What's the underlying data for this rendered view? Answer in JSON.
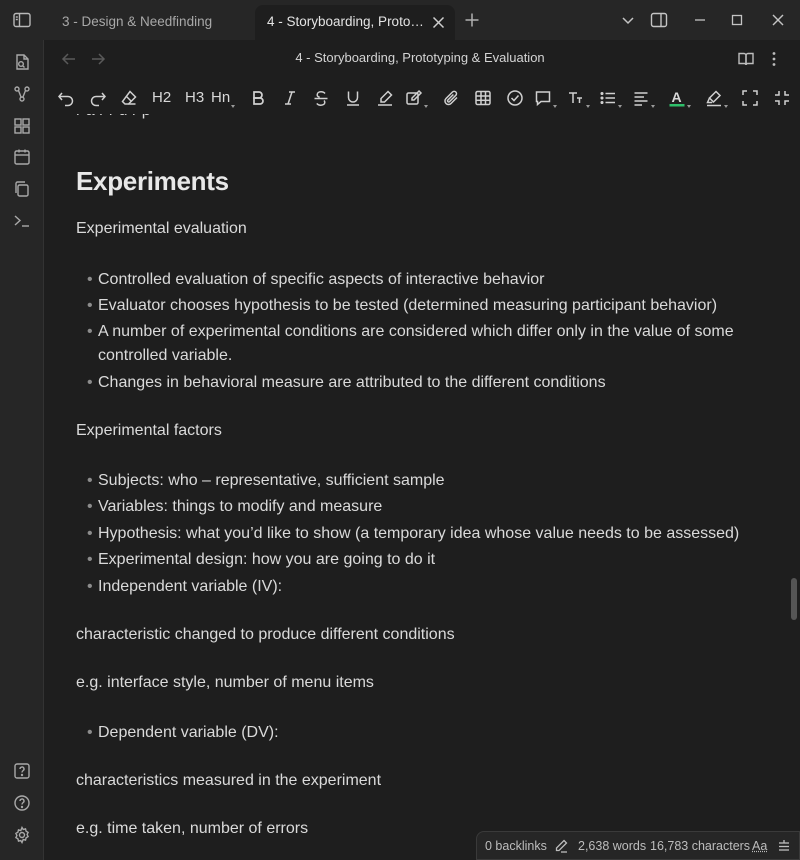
{
  "tabs": [
    {
      "title": "3 - Design & Needfinding"
    },
    {
      "title": "4 - Storyboarding, Prototyping & Evaluation"
    }
  ],
  "view": {
    "title": "4 - Storyboarding, Prototyping & Evaluation"
  },
  "toolbar": {
    "h2": "H2",
    "h3": "H3",
    "hn": "Hn"
  },
  "note": {
    "heading": "Experiments",
    "sections": [
      {
        "title": "Experimental evaluation",
        "bullets": [
          "Controlled evaluation of specific aspects of interactive behavior",
          "Evaluator chooses hypothesis to be tested (determined measuring participant behavior)",
          "A number of experimental conditions are considered which differ only in the value of some controlled variable.",
          "Changes in behavioral measure are attributed to the different conditions"
        ]
      },
      {
        "title": "Experimental factors",
        "bullets": [
          "Subjects: who – representative, sufficient sample",
          "Variables: things to modify and measure",
          "Hypothesis: what you’d like to show (a temporary idea whose value needs to be assessed)",
          "Experimental design: how you are going to do it",
          "Independent variable (IV):"
        ]
      }
    ],
    "iv_description": "characteristic changed to produce different conditions",
    "iv_example": "e.g. interface style, number of menu items",
    "dv_bullet": "Dependent variable (DV):",
    "dv_description": "characteristics measured in the experiment",
    "dv_example": "e.g. time taken, number of errors"
  },
  "status": {
    "backlinks": "0 backlinks",
    "words": "2,638 words",
    "characters": "16,783 characters",
    "font_toggle": "Aa"
  },
  "colors": {
    "text_color_accent": "#2ebf6a",
    "bg": "#1e1e1e",
    "chrome": "#262626"
  }
}
